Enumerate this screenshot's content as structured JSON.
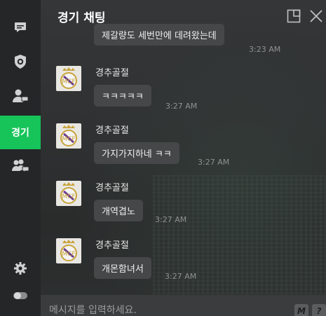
{
  "header": {
    "title": "경기 채팅"
  },
  "sidebar": {
    "active_label": "경기"
  },
  "messages": [
    {
      "author": "",
      "text": "제갈량도 세번만에 데려왔는데",
      "time": "3:23 AM"
    },
    {
      "author": "경추골절",
      "text": "ㅋㅋㅋㅋㅋ",
      "time": "3:27 AM"
    },
    {
      "author": "경추골절",
      "text": "가지가지하네 ㅋㅋ",
      "time": "3:27 AM"
    },
    {
      "author": "경추골절",
      "text": "개역겹노",
      "time": "3:27 AM"
    },
    {
      "author": "경추골절",
      "text": "개몬함녀서",
      "time": "3:27 AM"
    }
  ],
  "input": {
    "placeholder": "메시지를 입력하세요.",
    "btn_m": "M",
    "btn_q": "?"
  },
  "colors": {
    "accent": "#16c45a",
    "sidebar_bg": "#242628",
    "bubble_bg": "#454748"
  }
}
